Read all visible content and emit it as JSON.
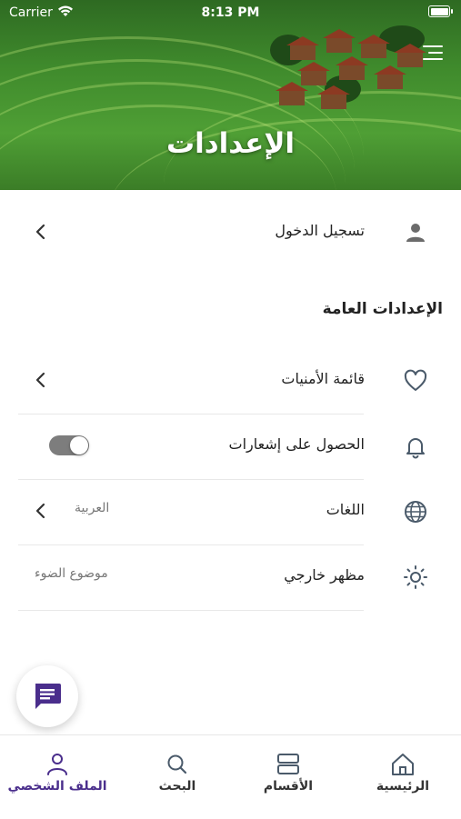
{
  "status_bar": {
    "carrier": "Carrier",
    "time": "8:13 PM"
  },
  "header": {
    "title": "الإعدادات"
  },
  "login": {
    "label": "تسجيل الدخول",
    "icon": "person-icon"
  },
  "general": {
    "title": "الإعدادات العامة",
    "items": [
      {
        "label": "قائمة الأمنيات",
        "icon": "heart-icon"
      },
      {
        "label": "الحصول على إشعارات",
        "icon": "bell-icon",
        "toggle_on": false
      },
      {
        "label": "اللغات",
        "value": "العربية",
        "icon": "globe-icon"
      },
      {
        "label": "مظهر خارجي",
        "value": "موضوع الضوء",
        "icon": "sun-icon"
      }
    ]
  },
  "tabs": [
    {
      "label": "الرئيسية",
      "icon": "home-icon"
    },
    {
      "label": "الأقسام",
      "icon": "categories-icon"
    },
    {
      "label": "البحث",
      "icon": "search-icon"
    },
    {
      "label": "الملف الشخصي",
      "icon": "profile-icon",
      "active": true
    }
  ],
  "colors": {
    "accent": "#4a2e8c",
    "toggle_off": "#7d7d7d",
    "icon": "#4a5a6a"
  }
}
